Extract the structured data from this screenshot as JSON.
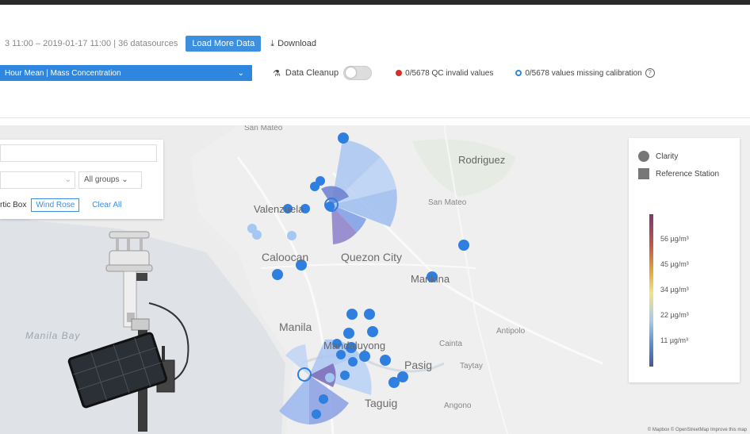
{
  "toolbar": {
    "date_range": "3 11:00 – 2019-01-17 11:00 | 36 datasources",
    "load_more_label": "Load More Data",
    "download_label": "Download"
  },
  "controls": {
    "metric_select_value": "Hour Mean | Mass Concentration",
    "cleanup_label": "Data Cleanup",
    "qc_text": "0/5678 QC invalid values",
    "calibration_text": "0/5678 values missing calibration"
  },
  "filter_panel": {
    "groups_select": "All groups",
    "buttons": [
      "rtic Box",
      "Wind Rose",
      "Clear All"
    ]
  },
  "map": {
    "labels": {
      "rodriguez": "Rodriguez",
      "valenzuela": "Valenzuela",
      "san_mateo": "San Mateo",
      "caloocan": "Caloocan",
      "quezon_city": "Quezon City",
      "marikina": "Marikina",
      "manila": "Manila",
      "mandaluyong": "Mandaluyong",
      "cainta": "Cainta",
      "antipolo": "Antipolo",
      "pasig": "Pasig",
      "taytay": "Taytay",
      "taguig": "Taguig",
      "angono": "Angono",
      "manila_bay": "Manila Bay"
    },
    "attribution": "© Mapbox © OpenStreetMap Improve this map"
  },
  "legend": {
    "items": [
      "Clarity",
      "Reference Station"
    ],
    "scale_ticks": [
      "56 µg/m³",
      "45 µg/m³",
      "34 µg/m³",
      "22 µg/m³",
      "11 µg/m³"
    ]
  },
  "colors": {
    "accent": "#3d8fe0",
    "sensor_dot": "#2f7fe0",
    "qc_invalid": "#d62d2d"
  },
  "icons": [
    "download-icon",
    "cleanup-icon",
    "chevron-down-icon",
    "help-icon",
    "weather-station-device-icon"
  ]
}
